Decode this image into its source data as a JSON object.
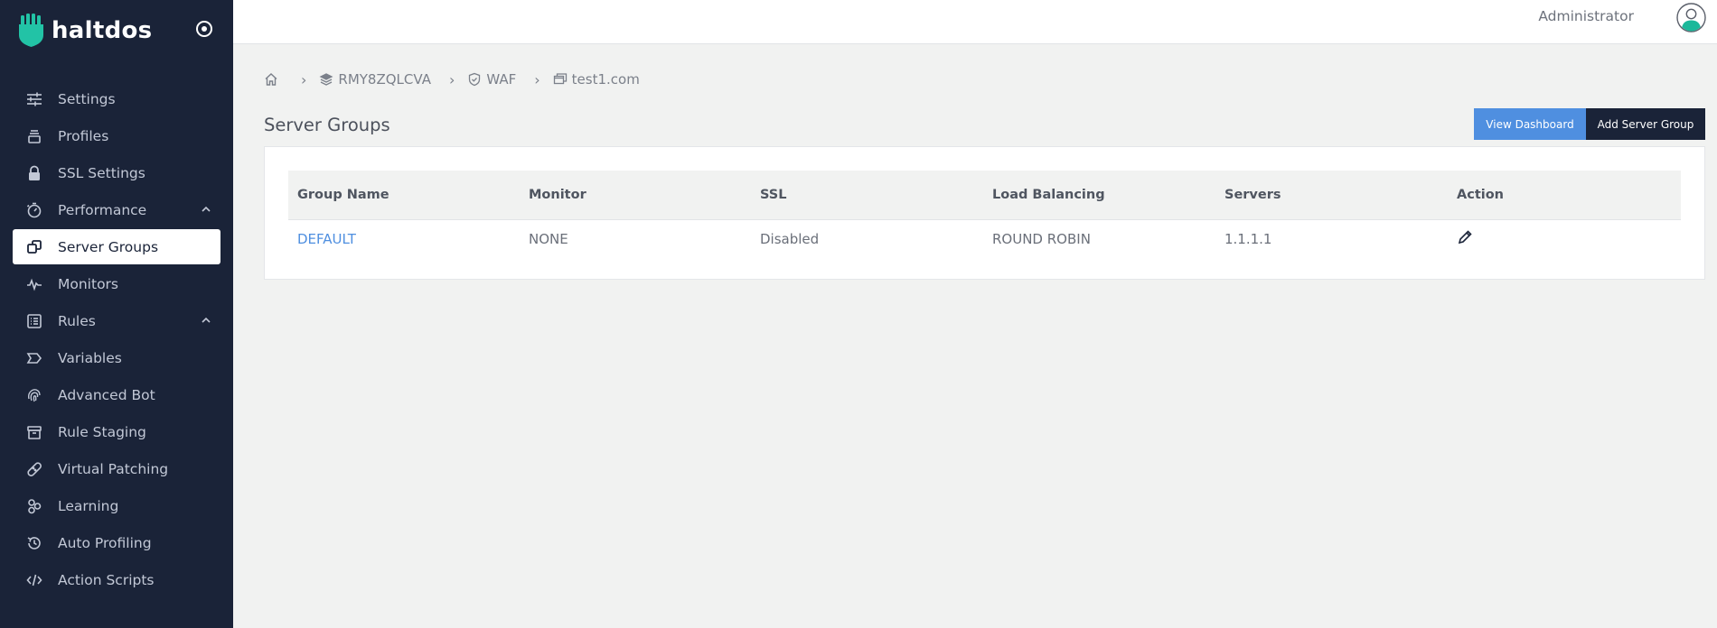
{
  "brand": {
    "name": "haltdos"
  },
  "sidebar": {
    "items": [
      {
        "label": "Settings",
        "icon": "sliders-icon"
      },
      {
        "label": "Profiles",
        "icon": "layers-icon"
      },
      {
        "label": "SSL Settings",
        "icon": "lock-icon"
      },
      {
        "label": "Performance",
        "icon": "speedometer-icon",
        "expanded": true
      },
      {
        "label": "Server Groups",
        "icon": "copy-icon",
        "active": true
      },
      {
        "label": "Monitors",
        "icon": "pulse-icon"
      },
      {
        "label": "Rules",
        "icon": "list-icon",
        "expanded": true
      },
      {
        "label": "Variables",
        "icon": "tag-icon"
      },
      {
        "label": "Advanced Bot",
        "icon": "fingerprint-icon"
      },
      {
        "label": "Rule Staging",
        "icon": "archive-icon"
      },
      {
        "label": "Virtual Patching",
        "icon": "bandage-icon"
      },
      {
        "label": "Learning",
        "icon": "nodes-icon"
      },
      {
        "label": "Auto Profiling",
        "icon": "history-icon"
      },
      {
        "label": "Action Scripts",
        "icon": "code-icon"
      }
    ]
  },
  "topbar": {
    "user": "Administrator"
  },
  "breadcrumb": {
    "items": [
      {
        "label": "",
        "icon": "home-icon"
      },
      {
        "label": "RMY8ZQLCVA",
        "icon": "stack-icon"
      },
      {
        "label": "WAF",
        "icon": "shield-icon"
      },
      {
        "label": "test1.com",
        "icon": "window-icon"
      }
    ],
    "separator": "›"
  },
  "page": {
    "title": "Server Groups",
    "view_dashboard_label": "View Dashboard",
    "add_group_label": "Add Server Group"
  },
  "table": {
    "columns": [
      "Group Name",
      "Monitor",
      "SSL",
      "Load Balancing",
      "Servers",
      "Action"
    ],
    "rows": [
      {
        "group_name": "DEFAULT",
        "monitor": "NONE",
        "ssl": "Disabled",
        "load_balancing": "ROUND ROBIN",
        "servers": "1.1.1.1",
        "action_icon": "pencil-icon"
      }
    ]
  },
  "colors": {
    "sidebar_bg": "#1a2338",
    "accent_blue": "#4f8fe0",
    "page_bg": "#f1f2f1",
    "avatar_teal": "#1bb89a"
  }
}
